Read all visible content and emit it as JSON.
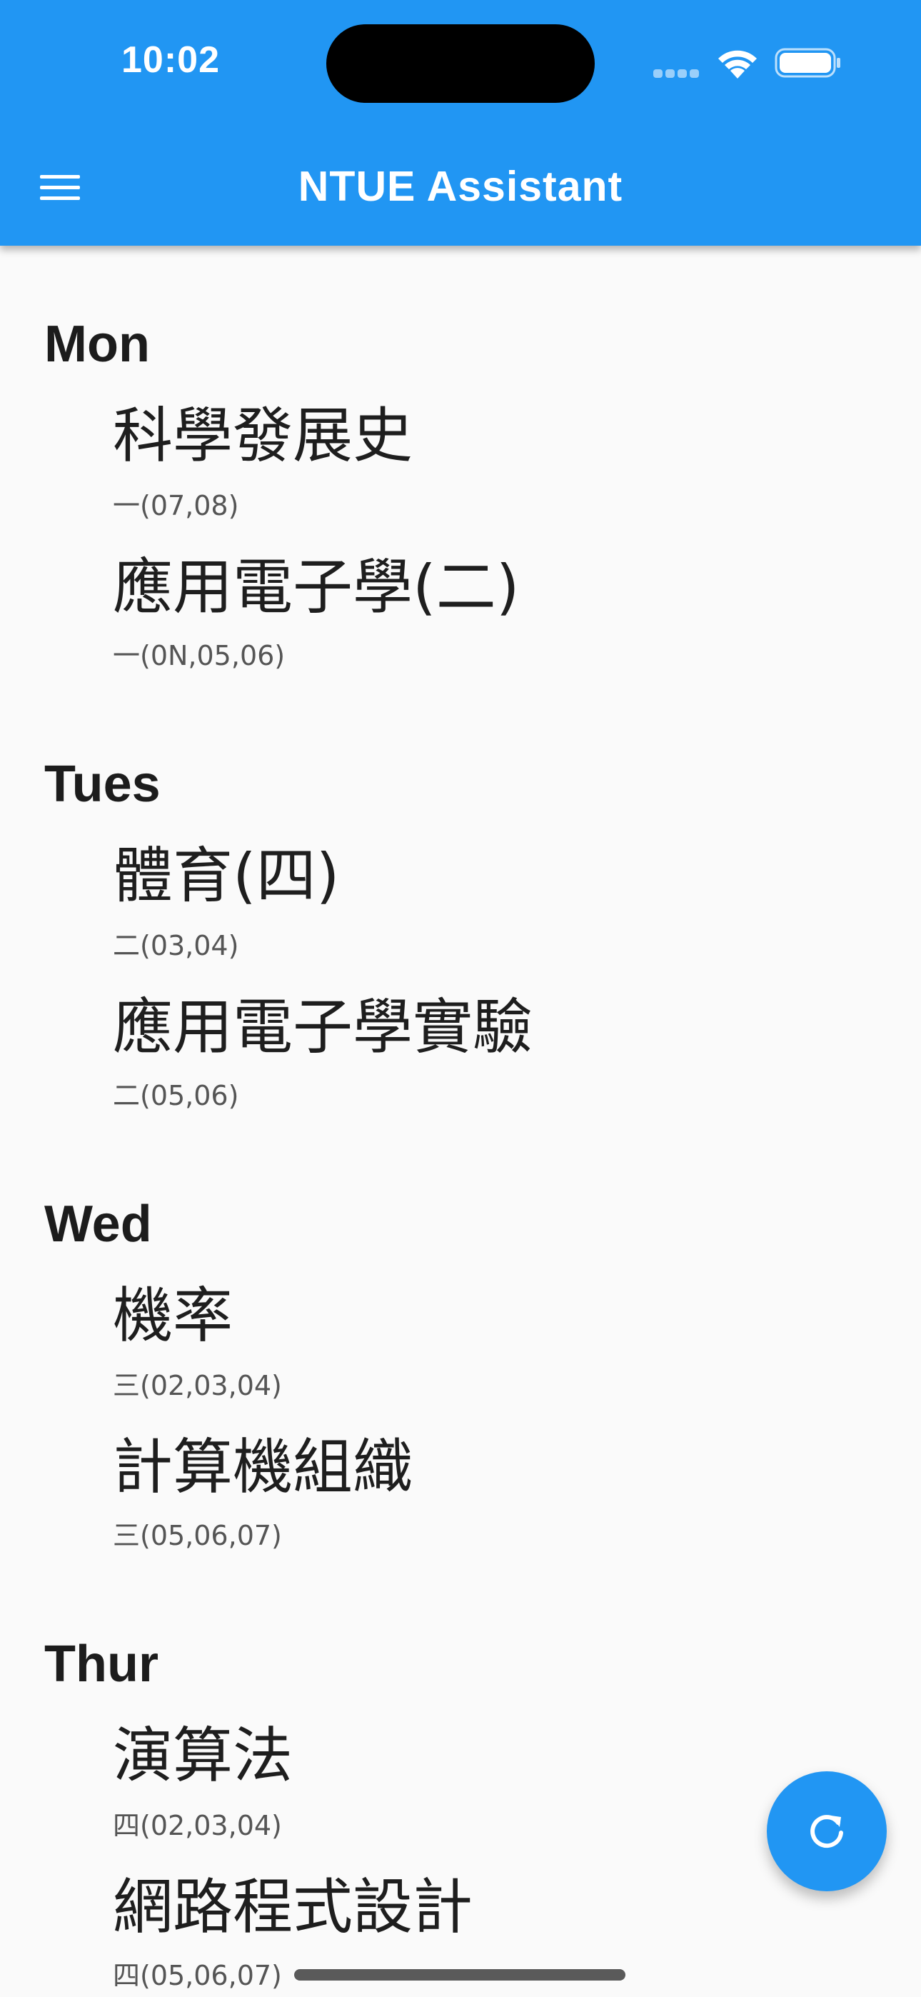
{
  "status_bar": {
    "time": "10:02"
  },
  "app_bar": {
    "title": "NTUE Assistant",
    "menu_icon": "hamburger-menu-icon",
    "background": "#2196f3"
  },
  "schedule": [
    {
      "day": "Mon",
      "courses": [
        {
          "title": "科學發展史",
          "time": "一(07,08)"
        },
        {
          "title": "應用電子學(二)",
          "time": "一(0N,05,06)"
        }
      ]
    },
    {
      "day": "Tues",
      "courses": [
        {
          "title": "體育(四)",
          "time": "二(03,04)"
        },
        {
          "title": "應用電子學實驗",
          "time": "二(05,06)"
        }
      ]
    },
    {
      "day": "Wed",
      "courses": [
        {
          "title": "機率",
          "time": "三(02,03,04)"
        },
        {
          "title": "計算機組織",
          "time": "三(05,06,07)"
        }
      ]
    },
    {
      "day": "Thur",
      "courses": [
        {
          "title": "演算法",
          "time": "四(02,03,04)"
        },
        {
          "title": "網路程式設計",
          "time": "四(05,06,07)"
        }
      ]
    }
  ],
  "fab": {
    "icon": "refresh-icon",
    "color": "#2196f3"
  }
}
